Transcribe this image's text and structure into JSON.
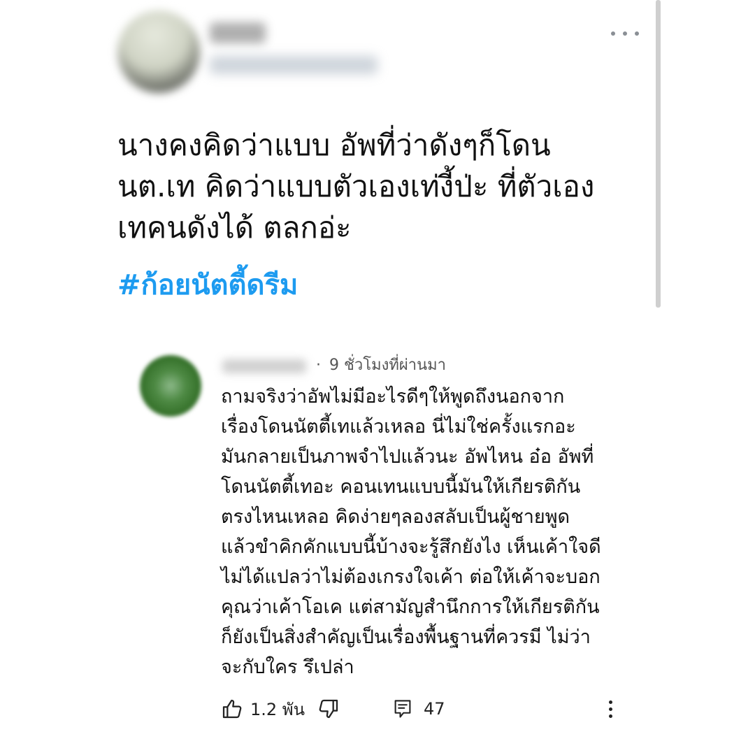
{
  "tweet": {
    "text": "นางคงคิดว่าแบบ อัพที่ว่าดังๆก็โดน\nนต.เท คิดว่าแบบตัวเองเท่งี้ป่ะ ที่ตัวเอง\nเทคนดังได้ ตลกอ่ะ",
    "hashtag": "#ก้อยนัตตี้ดรีม"
  },
  "comment": {
    "time": "9 ชั่วโมงที่ผ่านมา",
    "text": "ถามจริงว่าอัพไม่มีอะไรดีๆให้พูดถึงนอกจาก\nเรื่องโดนนัตตี้เทแล้วเหลอ นี่ไม่ใช่ครั้งแรกอะ\nมันกลายเป็นภาพจำไปแล้วนะ อัพไหน อ๋อ อัพที่\nโดนนัตตี้เทอะ คอนเทนแบบนี้มันให้เกียรติกัน\nตรงไหนเหลอ คิดง่ายๆลองสลับเป็นผู้ชายพูด\nแล้วขำคิกคักแบบนี้บ้างจะรู้สึกยังไง เห็นเค้าใจดี\nไม่ได้แปลว่าไม่ต้องเกรงใจเค้า ต่อให้เค้าจะบอก\nคุณว่าเค้าโอเค แต่สามัญสำนึกการให้เกียรติกัน\nก็ยังเป็นสิ่งสำคัญเป็นเรื่องพื้นฐานที่ควรมี ไม่ว่า\nจะกับใคร รึเปล่า",
    "likes": "1.2 พัน",
    "replies": "47"
  },
  "colors": {
    "hashtag": "#1d9bf0",
    "text": "#111111",
    "meta": "#555555"
  },
  "icons": [
    "more-horizontal-icon",
    "thumbs-up-icon",
    "thumbs-down-icon",
    "comment-icon",
    "more-vertical-icon"
  ]
}
